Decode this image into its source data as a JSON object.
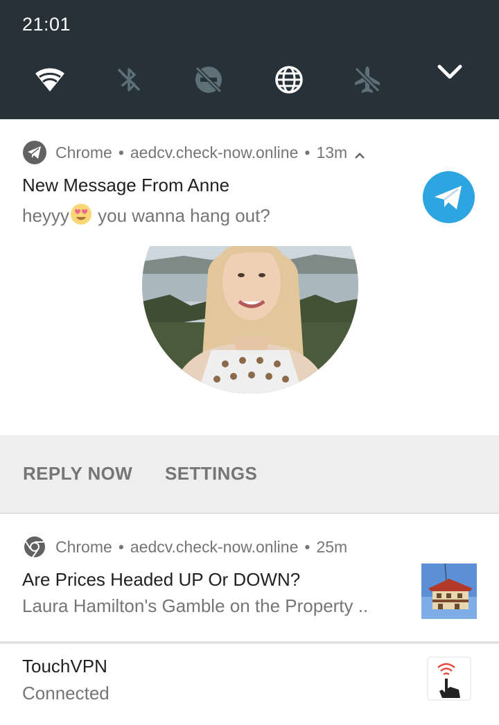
{
  "status_bar": {
    "time": "21:01"
  },
  "quick_settings": {
    "tiles": [
      {
        "name": "wifi-icon",
        "state": "on"
      },
      {
        "name": "bluetooth-off-icon",
        "state": "off"
      },
      {
        "name": "do-not-disturb-off-icon",
        "state": "off"
      },
      {
        "name": "globe-icon",
        "state": "on"
      },
      {
        "name": "airplane-mode-off-icon",
        "state": "off"
      }
    ],
    "expand_icon": "chevron-down-icon"
  },
  "notifications": [
    {
      "app": "Chrome",
      "source": "aedcv.check-now.online",
      "time": "13m",
      "title": "New Message From Anne",
      "text_before_emoji": "heyyy",
      "emoji": "heart-eyes-emoji",
      "text_after_emoji": " you wanna hang out?",
      "large_icon": "telegram-icon",
      "image": "profile-photo",
      "actions": [
        "REPLY NOW",
        "SETTINGS"
      ]
    },
    {
      "app": "Chrome",
      "source": "aedcv.check-now.online",
      "time": "25m",
      "title": "Are Prices Headed UP Or DOWN?",
      "text": "Laura Hamilton's Gamble on the Property ..",
      "thumbnail": "house-photo"
    },
    {
      "title": "TouchVPN",
      "text": "Connected",
      "large_icon": "touchvpn-icon"
    }
  ],
  "colors": {
    "shade_background": "#263238",
    "telegram_blue": "#2ca5e0",
    "action_bar": "#eeeeee"
  }
}
